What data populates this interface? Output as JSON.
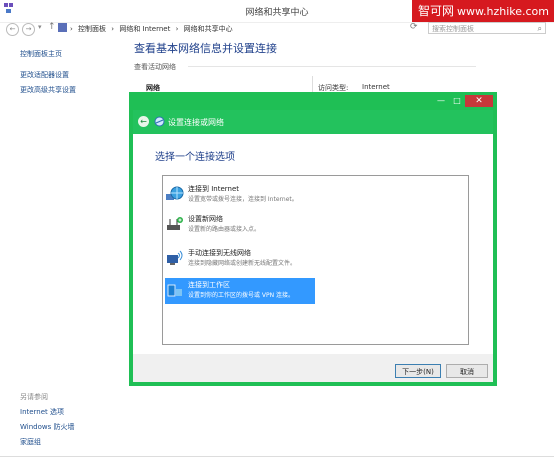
{
  "window": {
    "title": "网络和共享中心"
  },
  "watermark": {
    "brand": "智可网",
    "url": "www.hzhike.com"
  },
  "address_bar": {
    "breadcrumbs": [
      "控制面板",
      "网络和 Internet",
      "网络和共享中心"
    ],
    "search_placeholder": "搜索控制面板"
  },
  "sidebar": {
    "home": "控制面板主页",
    "links": [
      "更改适配器设置",
      "更改高级共享设置"
    ],
    "see_also_label": "另请参阅",
    "see_also": [
      "Internet 选项",
      "Windows 防火墙",
      "家庭组"
    ]
  },
  "main": {
    "title": "查看基本网络信息并设置连接",
    "section_label": "查看活动网络",
    "network_name": "网络",
    "access_type_label": "访问类型:",
    "access_type_value": "Internet"
  },
  "dialog": {
    "title": "设置连接或网络",
    "heading": "选择一个连接选项",
    "options": [
      {
        "title": "连接到 Internet",
        "desc": "设置宽带或拨号连接，连接到 Internet。",
        "icon": "globe-network-icon"
      },
      {
        "title": "设置新网络",
        "desc": "设置新的路由器或接入点。",
        "icon": "router-icon"
      },
      {
        "title": "手动连接到无线网络",
        "desc": "连接到隐藏网络或创建新无线配置文件。",
        "icon": "wireless-computer-icon"
      },
      {
        "title": "连接到工作区",
        "desc": "设置到你的工作区的拨号或 VPN 连接。",
        "icon": "workplace-vpn-icon",
        "selected": true
      }
    ],
    "next_label": "下一步(N)",
    "cancel_label": "取消"
  },
  "colors": {
    "dialog_border": "#1fbf55",
    "selection": "#3399ff",
    "close": "#c7373a",
    "watermark": "#d6191f"
  }
}
